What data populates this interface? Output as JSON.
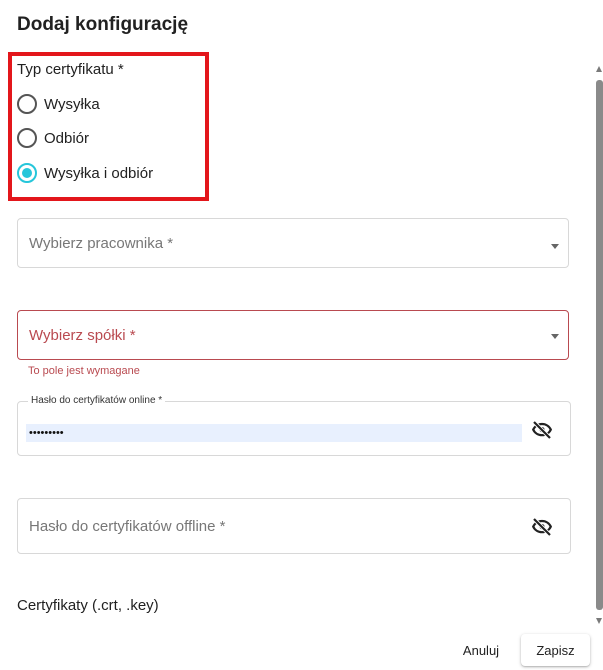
{
  "dialog": {
    "title": "Dodaj konfigurację"
  },
  "certificate_type": {
    "label": "Typ certyfikatu *",
    "options": [
      {
        "label": "Wysyłka",
        "selected": false
      },
      {
        "label": "Odbiór",
        "selected": false
      },
      {
        "label": "Wysyłka i odbiór",
        "selected": true
      }
    ],
    "highlight_color": "#e3161b",
    "accent_color": "#26c6da"
  },
  "employee_select": {
    "placeholder": "Wybierz pracownika *"
  },
  "company_select": {
    "placeholder": "Wybierz spółki *",
    "error": "To pole jest wymagane",
    "error_color": "#b94a50"
  },
  "online_password": {
    "label": "Hasło do certyfikatów online *",
    "value": "•••••••••",
    "icon": "eye-off-icon"
  },
  "offline_password": {
    "placeholder": "Hasło do certyfikatów offline *",
    "icon": "eye-off-icon"
  },
  "certificates": {
    "label": "Certyfikaty (.crt, .key)"
  },
  "actions": {
    "cancel": "Anuluj",
    "save": "Zapisz"
  }
}
